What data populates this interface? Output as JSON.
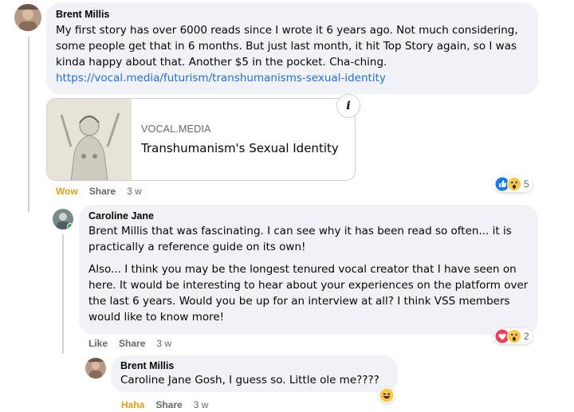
{
  "comment1": {
    "author": "Brent Millis",
    "text": "My first story has over 6000 reads since I wrote it 6 years ago. Not much considering, some people get that in 6 months. But just last month, it hit Top Story again, so I was kinda happy about that. Another $5 in the pocket. Cha-ching.",
    "link": "https://vocal.media/futurism/transhumanisms-sexual-identity",
    "preview": {
      "domain": "VOCAL.MEDIA",
      "title": "Transhumanism's Sexual Identity",
      "info_glyph": "i"
    },
    "actions": {
      "reaction": "Wow",
      "share": "Share",
      "time": "3 w"
    },
    "reactions": {
      "icons": [
        "like-icon",
        "wow-icon"
      ],
      "count": "5"
    }
  },
  "reply1": {
    "author": "Caroline Jane",
    "mention": "Brent Millis",
    "text_p1": " that was fascinating. I can see why it has been read so often... it is practically a reference guide on its own!",
    "text_p2": "Also... I think you may be the longest tenured vocal creator that I have seen on here. It would be interesting to hear about your experiences on the platform over the last 6 years. Would you be up for an interview at all? I think VSS members would like to know more!",
    "actions": {
      "like": "Like",
      "share": "Share",
      "time": "3 w"
    },
    "reactions": {
      "icons": [
        "love-icon",
        "wow-icon"
      ],
      "count": "2"
    }
  },
  "reply2": {
    "author": "Brent Millis",
    "mention": "Caroline Jane",
    "text": " Gosh, I guess so. Little ole me????",
    "actions": {
      "reaction": "Haha",
      "share": "Share",
      "time": "3 w"
    },
    "reactions": {
      "icons": [
        "haha-icon"
      ]
    }
  },
  "colors": {
    "bubble": "#f0f2f5",
    "link": "#216fdb",
    "meta": "#65676b",
    "wow_haha": "#e4a01b",
    "like_blue": "#1877f2",
    "love_red": "#f33e58"
  }
}
